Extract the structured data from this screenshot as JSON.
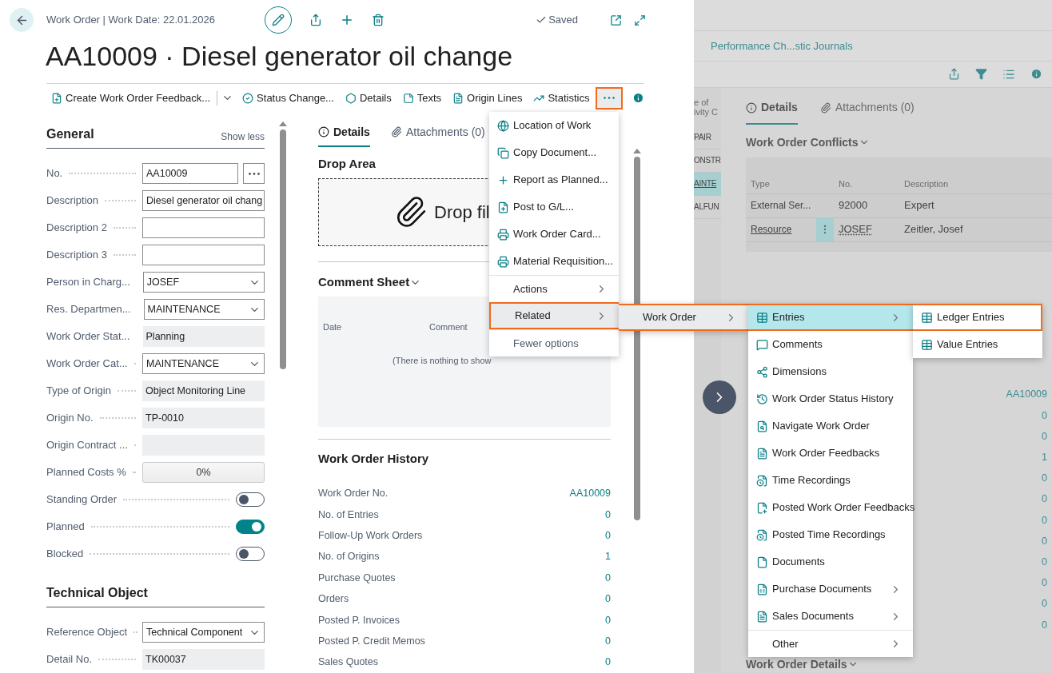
{
  "header": {
    "breadcrumb": "Work Order | Work Date: 22.01.2026",
    "status": "Saved",
    "title": "AA10009 · Diesel generator oil change"
  },
  "actions": [
    {
      "label": "Create Work Order Feedback...",
      "kind": "split"
    },
    {
      "label": "Status Change...",
      "kind": "plain"
    },
    {
      "label": "Details",
      "kind": "plain"
    },
    {
      "label": "Texts",
      "kind": "plain"
    },
    {
      "label": "Origin Lines",
      "kind": "plain"
    },
    {
      "label": "Statistics",
      "kind": "plain"
    }
  ],
  "more_button": {
    "highlighted": true
  },
  "general": {
    "title": "General",
    "toggle": "Show less",
    "fields": [
      {
        "label": "No.",
        "kind": "lookup",
        "value": "AA10009"
      },
      {
        "label": "Description",
        "kind": "text",
        "value": "Diesel generator oil chang"
      },
      {
        "label": "Description 2",
        "kind": "text"
      },
      {
        "label": "Description 3",
        "kind": "text"
      },
      {
        "label": "Person in Charg...",
        "kind": "select",
        "value": "JOSEF"
      },
      {
        "label": "Res. Departmen...",
        "kind": "select",
        "value": "MAINTENANCE"
      },
      {
        "label": "Work Order Stat...",
        "kind": "readonly",
        "value": "Planning"
      },
      {
        "label": "Work Order Cat...",
        "kind": "select",
        "value": "MAINTENANCE"
      },
      {
        "label": "Type of Origin",
        "kind": "readonly",
        "value": "Object Monitoring Line"
      },
      {
        "label": "Origin No.",
        "kind": "readonly",
        "value": "TP-0010"
      },
      {
        "label": "Origin Contract ...",
        "kind": "readonly"
      },
      {
        "label": "Planned Costs %",
        "kind": "percent",
        "value": "0%"
      },
      {
        "label": "Standing Order",
        "kind": "toggle",
        "on": false
      },
      {
        "label": "Planned",
        "kind": "toggle",
        "on": true
      },
      {
        "label": "Blocked",
        "kind": "toggle",
        "on": false
      }
    ]
  },
  "technical_object": {
    "title": "Technical Object",
    "fields": [
      {
        "label": "Reference Object",
        "kind": "select",
        "value": "Technical Component"
      },
      {
        "label": "Detail No.",
        "kind": "readonly",
        "value": "TK00037"
      }
    ]
  },
  "factbox": {
    "tabs": [
      {
        "label": "Details",
        "selected": true
      },
      {
        "label": "Attachments (0)",
        "selected": false
      }
    ],
    "drop_area": {
      "title": "Drop Area",
      "text": "Drop fil"
    },
    "comment_sheet": {
      "title": "Comment Sheet",
      "columns": [
        "Date",
        "Comment"
      ],
      "empty_text": "(There is nothing to show"
    },
    "history": {
      "title": "Work Order History",
      "rows": [
        {
          "label": "Work Order No.",
          "value": "AA10009"
        },
        {
          "label": "No. of Entries",
          "value": "0"
        },
        {
          "label": "Follow-Up Work Orders",
          "value": "0"
        },
        {
          "label": "No. of Origins",
          "value": "1"
        },
        {
          "label": "Purchase Quotes",
          "value": "0"
        },
        {
          "label": "Orders",
          "value": "0"
        },
        {
          "label": "Posted P. Invoices",
          "value": "0"
        },
        {
          "label": "Posted P. Credit Memos",
          "value": "0"
        },
        {
          "label": "Sales Quotes",
          "value": "0"
        }
      ]
    }
  },
  "background_page": {
    "link": "Performance Ch...stic Journals",
    "column_header": [
      "e of",
      "ivity C"
    ],
    "list_rows": [
      {
        "text": "PAIR",
        "selected": false
      },
      {
        "text": "ONSTR",
        "selected": false
      },
      {
        "text": "AINTE",
        "selected": true
      },
      {
        "text": "ALFUN",
        "selected": false
      }
    ],
    "tabs": [
      {
        "label": "Details",
        "selected": true
      },
      {
        "label": "Attachments (0)",
        "selected": false
      }
    ],
    "conflicts": {
      "title": "Work Order Conflicts",
      "columns": [
        "Type",
        "No.",
        "Description"
      ],
      "rows": [
        {
          "type": "External Ser...",
          "no": "92000",
          "description": "Expert",
          "selected": false
        },
        {
          "type": "Resource",
          "no": "JOSEF",
          "description": "Zeitler, Josef",
          "selected": true
        }
      ]
    },
    "history_values": [
      "AA10009",
      "0",
      "0",
      "1",
      "0",
      "0",
      "0",
      "0",
      "0",
      "0",
      "0",
      "0"
    ],
    "details_title": "Work Order Details"
  },
  "menus": [
    {
      "items": [
        {
          "label": "Location of Work",
          "kind": "action",
          "selected": false,
          "highlighted": false
        },
        {
          "label": "Copy Document...",
          "kind": "action",
          "selected": false,
          "highlighted": false
        },
        {
          "label": "Report as Planned...",
          "kind": "action",
          "selected": false,
          "highlighted": false
        },
        {
          "label": "Post to G/L...",
          "kind": "action",
          "selected": false,
          "highlighted": false
        },
        {
          "label": "Work Order Card...",
          "kind": "action",
          "selected": false,
          "highlighted": false
        },
        {
          "label": "Material Requisition...",
          "kind": "action",
          "selected": false,
          "highlighted": false
        },
        {
          "label": "Actions",
          "kind": "group",
          "selected": false,
          "highlighted": false
        },
        {
          "label": "Related",
          "kind": "group",
          "selected": true,
          "highlighted": true
        },
        {
          "label": "Fewer options",
          "kind": "option",
          "selected": false,
          "highlighted": false
        }
      ]
    },
    {
      "items": [
        {
          "label": "Work Order",
          "kind": "group",
          "selected": true,
          "highlighted": true
        }
      ]
    },
    {
      "items": [
        {
          "label": "Entries",
          "kind": "submenu",
          "selected": true,
          "highlighted": true
        },
        {
          "label": "Comments",
          "kind": "action",
          "selected": false,
          "highlighted": false
        },
        {
          "label": "Dimensions",
          "kind": "action",
          "selected": false,
          "highlighted": false
        },
        {
          "label": "Work Order Status History",
          "kind": "action",
          "selected": false,
          "highlighted": false
        },
        {
          "label": "Navigate Work Order",
          "kind": "action",
          "selected": false,
          "highlighted": false
        },
        {
          "label": "Work Order Feedbacks",
          "kind": "action",
          "selected": false,
          "highlighted": false
        },
        {
          "label": "Time Recordings",
          "kind": "action",
          "selected": false,
          "highlighted": false
        },
        {
          "label": "Posted Work Order Feedbacks",
          "kind": "action",
          "selected": false,
          "highlighted": false
        },
        {
          "label": "Posted Time Recordings",
          "kind": "action",
          "selected": false,
          "highlighted": false
        },
        {
          "label": "Documents",
          "kind": "action",
          "selected": false,
          "highlighted": false
        },
        {
          "label": "Purchase Documents",
          "kind": "submenu",
          "selected": false,
          "highlighted": false
        },
        {
          "label": "Sales Documents",
          "kind": "submenu",
          "selected": false,
          "highlighted": false
        },
        {
          "label": "Other",
          "kind": "group",
          "selected": false,
          "highlighted": false
        }
      ]
    },
    {
      "items": [
        {
          "label": "Ledger Entries",
          "kind": "action",
          "selected": false,
          "highlighted": true
        },
        {
          "label": "Value Entries",
          "kind": "action",
          "selected": false,
          "highlighted": false
        }
      ]
    }
  ]
}
